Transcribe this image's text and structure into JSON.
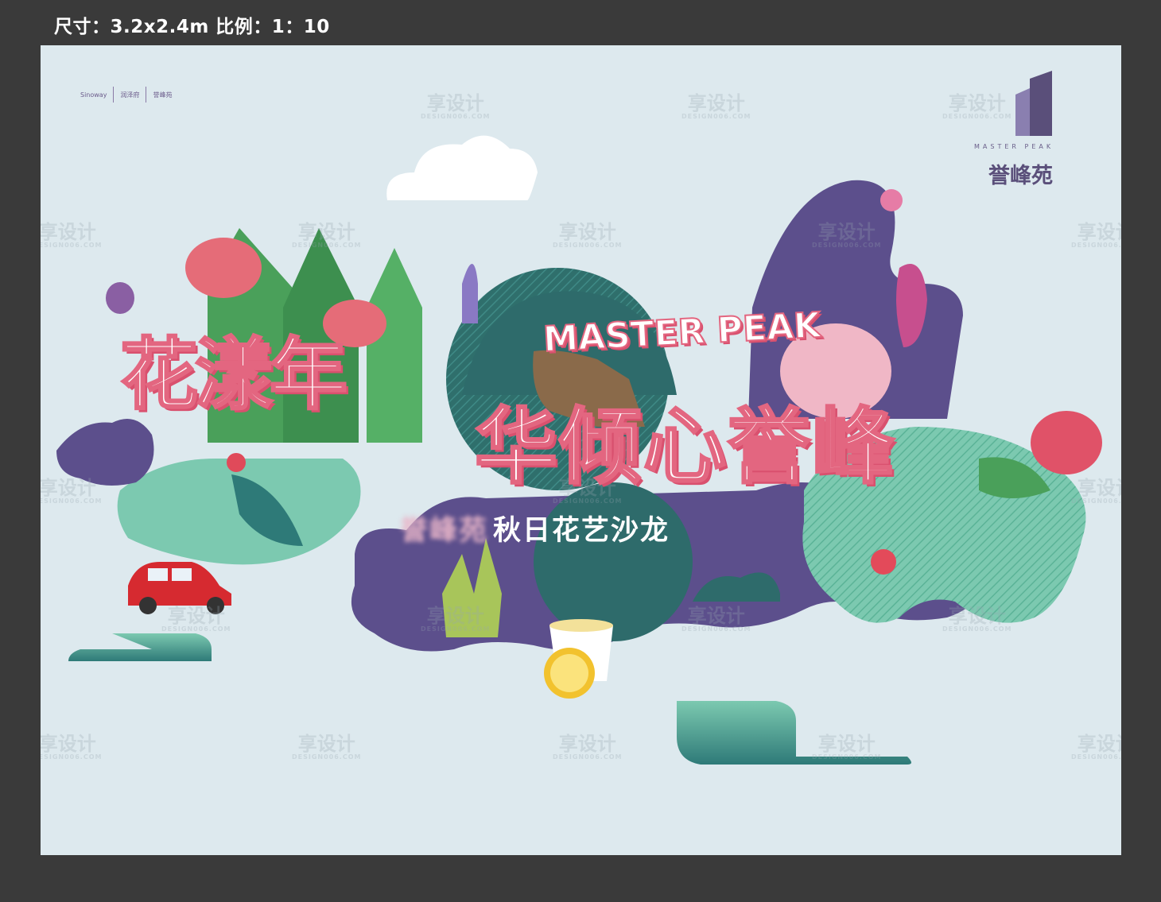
{
  "spec_label": "尺寸：3.2x2.4m 比例：1：10",
  "title": {
    "line1": "花漾年",
    "line2": "华倾心誉峰",
    "english": "MASTER PEAK"
  },
  "subtitle": {
    "blurred": "誉峰苑",
    "text": "秋日花艺沙龙"
  },
  "logo": {
    "english": "MASTER PEAK",
    "chinese": "誉峰苑"
  },
  "partners": [
    "Sinoway",
    "润泽府",
    "誉峰苑"
  ],
  "watermark": {
    "text": "享设计",
    "url": "DESIGN006.COM"
  },
  "colors": {
    "background": "#dde9ee",
    "frame": "#3a3a3a",
    "purple": "#5c4f8c",
    "teal": "#2e6b6b",
    "mint": "#7cc9b0",
    "pink": "#e36680",
    "green": "#4aa05a"
  }
}
